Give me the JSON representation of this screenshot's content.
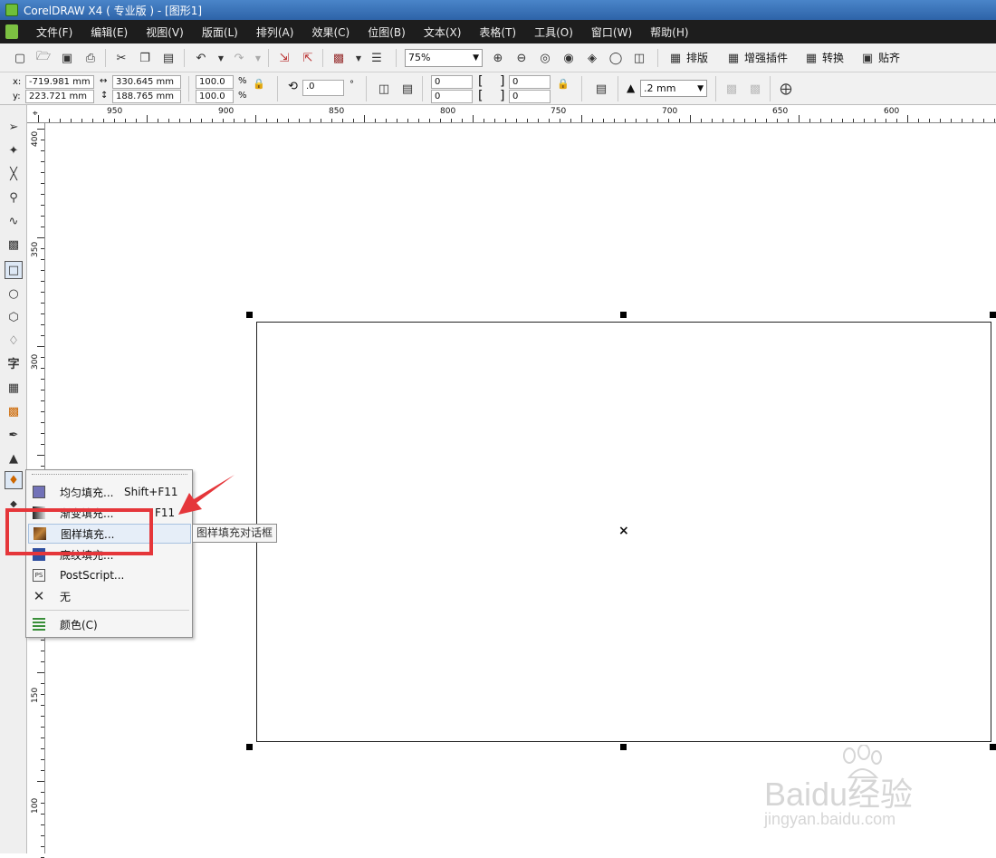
{
  "window": {
    "title": "CorelDRAW X4 ( 专业版 ) - [图形1]"
  },
  "menubar": {
    "items": [
      "文件(F)",
      "编辑(E)",
      "视图(V)",
      "版面(L)",
      "排列(A)",
      "效果(C)",
      "位图(B)",
      "文本(X)",
      "表格(T)",
      "工具(O)",
      "窗口(W)",
      "帮助(H)"
    ]
  },
  "toolbar": {
    "zoom_value": "75%",
    "layout_label": "排版",
    "plugin_label": "增强插件",
    "convert_label": "转换",
    "snap_label": "贴齐"
  },
  "propbar": {
    "x_label": "x:",
    "x_value": "-719.981 mm",
    "y_label": "y:",
    "y_value": "223.721 mm",
    "width_value": "330.645 mm",
    "height_value": "188.765 mm",
    "scale_x": "100.0",
    "scale_y": "100.0",
    "percent": "%",
    "rotation": ".0",
    "degree": "°",
    "corner_1": "0",
    "corner_2": "0",
    "corner_3": "0",
    "corner_4": "0",
    "outline_width": ".2 mm"
  },
  "ruler": {
    "h_labels": [
      "950",
      "900",
      "850",
      "800",
      "750",
      "700",
      "650",
      "600"
    ],
    "v_labels": [
      "400",
      "350",
      "300",
      "150",
      "100"
    ]
  },
  "fill_menu": {
    "items": [
      {
        "label": "均匀填充...",
        "shortcut": "Shift+F11"
      },
      {
        "label": "渐变填充...",
        "shortcut": "F11"
      },
      {
        "label": "图样填充...",
        "shortcut": ""
      },
      {
        "label": "底纹填充...",
        "shortcut": ""
      },
      {
        "label": "PostScript...",
        "shortcut": ""
      },
      {
        "label": "无",
        "shortcut": ""
      },
      {
        "label": "颜色(C)",
        "shortcut": ""
      }
    ],
    "tooltip": "图样填充对话框"
  },
  "watermark": {
    "brand": "Baidu经验",
    "url": "jingyan.baidu.com"
  },
  "colors": {
    "highlight_red": "#e5363a",
    "menu_bg": "#1d1d1d",
    "title_blue": "#2d63a8"
  }
}
